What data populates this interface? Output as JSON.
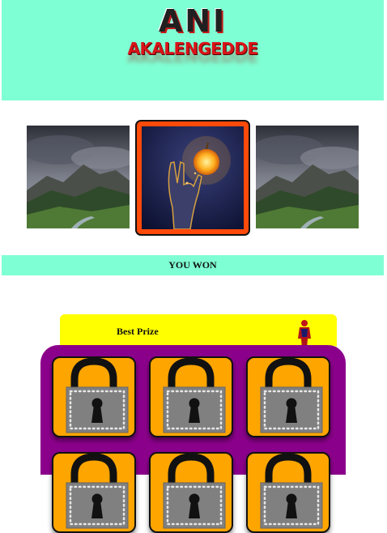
{
  "header": {
    "logo_line1": "ANI",
    "logo_line2": "AKALENGEDDE",
    "background_color": "#7fffd4"
  },
  "gallery": {
    "tiles": [
      {
        "image": "misty-mountain-landscape"
      },
      {
        "image": "hand-with-golden-apple",
        "selected": true,
        "highlight_color": "#ff4a0a"
      },
      {
        "image": "misty-mountain-landscape"
      }
    ]
  },
  "status": {
    "text": "YOU WON"
  },
  "prize": {
    "label": "Best Prize",
    "figure_icon": "superhero-figure-icon",
    "banner_color": "#ffff00"
  },
  "locker": {
    "background_color": "#8b008b",
    "cell_color": "#ffa500",
    "cells": [
      {
        "icon": "padlock-icon",
        "state": "locked"
      },
      {
        "icon": "padlock-icon",
        "state": "locked"
      },
      {
        "icon": "padlock-icon",
        "state": "locked"
      },
      {
        "icon": "padlock-icon",
        "state": "locked"
      },
      {
        "icon": "padlock-icon",
        "state": "locked"
      },
      {
        "icon": "padlock-icon",
        "state": "locked"
      }
    ]
  }
}
